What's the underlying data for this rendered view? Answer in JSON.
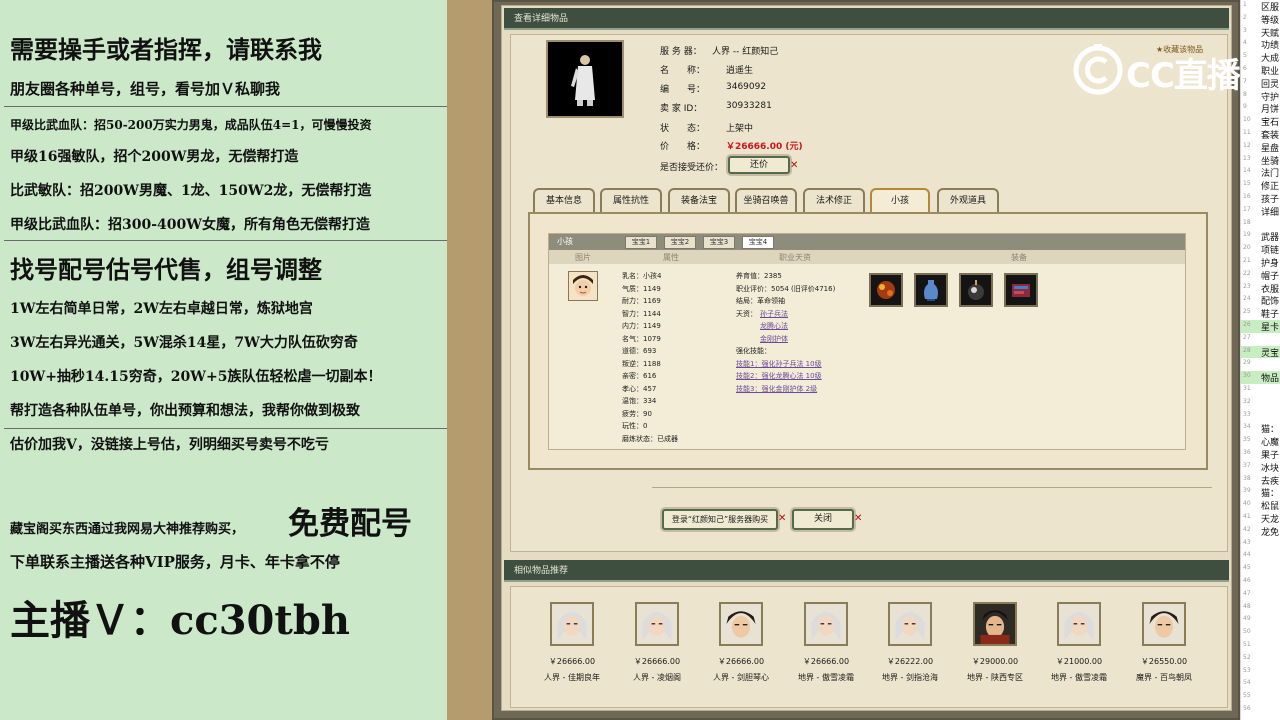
{
  "ad": {
    "lines": [
      "需要操手或者指挥，请联系我",
      "朋友圈各种单号，组号，看号加Ｖ私聊我",
      "甲级比武血队：招50-200万实力男鬼，成品队伍4=1，可慢慢投资",
      "甲级16强敏队，招个200W男龙，无偿帮打造",
      "比武敏队：招200W男魔、1龙、150W2龙，无偿帮打造",
      "甲级比武血队：招300-400W女魔，所有角色无偿帮打造",
      "找号配号估号代售，组号调整",
      "1W左右简单日常，2W左右卓越日常，炼狱地宫",
      "3W左右异光通关，5W混杀14星，7W大力队伍砍穷奇",
      "10W+抽秒14.15穷奇，20W+5族队伍轻松虐一切副本！",
      "帮打造各种队伍单号，你出预算和想法，我帮你做到极致",
      "估价加我V，没链接上号估，列明细买号卖号不吃亏",
      "藏宝阁买东西通过我网易大神推荐购买，",
      "免费配号",
      "下单联系主播送各种VIP服务，月卡、年卡拿不停",
      "主播Ｖ：cc30tbh"
    ]
  },
  "watermark": {
    "brand": "CC直播"
  },
  "detail": {
    "title": "查看详细物品",
    "favorite": "收藏该物品",
    "info": [
      {
        "label": "服 务 器：",
        "value": "人界 -- 红颜知己"
      },
      {
        "label": "名　　称：",
        "value": "逍遥生"
      },
      {
        "label": "编　　号：",
        "value": "3469092"
      },
      {
        "label": "卖 家 ID：",
        "value": "30933281"
      },
      {
        "label": "状　　态：",
        "value": "上架中"
      },
      {
        "label": "价　　格：",
        "value": "￥26666.00 (元)"
      }
    ],
    "bargain_label": "是否接受还价：",
    "bargain_button": "还价",
    "tabs": [
      "基本信息",
      "属性抗性",
      "装备法宝",
      "坐骑召唤兽",
      "法术修正",
      "小孩",
      "外观道具"
    ],
    "active_tab": 5,
    "child": {
      "title": "小孩",
      "subtabs": [
        "宝宝1",
        "宝宝2",
        "宝宝3",
        "宝宝4"
      ],
      "col_image": "图片",
      "col_attr": "属性",
      "col_skill": "职业天资",
      "col_equip": "装备",
      "stats": [
        "乳名：小孩4",
        "气质：1149",
        "耐力：1169",
        "智力：1144",
        "内力：1149",
        "名气：1079",
        "道德：693",
        "叛逆：1188",
        "亲密：616",
        "孝心：457",
        "温饱：334",
        "疲劳：90",
        "玩性：0",
        "磨炼状态：已成器"
      ],
      "career": [
        "养育值：2385",
        "职业评价：5054 (旧评价4716)",
        "结局：革命领袖"
      ],
      "talent_label": "天资：",
      "talents": [
        "孙子兵法",
        "龙腾心法",
        "金刚护体"
      ],
      "enhance_label": "强化技能：",
      "enhances": [
        "技能1：强化孙子兵法 10级",
        "技能2：强化龙腾心法 10级",
        "技能3：强化金刚护体 2级"
      ]
    },
    "login_button": "登录“红颜知己”服务器购买",
    "close_button": "关闭"
  },
  "recommend": {
    "title": "相似物品推荐",
    "items": [
      {
        "price": "￥26666.00",
        "server": "人界 - 佳期良年"
      },
      {
        "price": "￥26666.00",
        "server": "人界 - 凌烟阁"
      },
      {
        "price": "￥26666.00",
        "server": "人界 - 剑胆琴心"
      },
      {
        "price": "￥26666.00",
        "server": "地界 - 傲雪凌霜"
      },
      {
        "price": "￥26222.00",
        "server": "地界 - 剑指沧海"
      },
      {
        "price": "￥29000.00",
        "server": "地界 - 陕西专区"
      },
      {
        "price": "￥21000.00",
        "server": "地界 - 傲雪凌霜"
      },
      {
        "price": "￥26550.00",
        "server": "魔界 - 百鸟朝凤"
      }
    ]
  },
  "right_strip": [
    {
      "n": "1",
      "t": "区服"
    },
    {
      "n": "2",
      "t": "等级"
    },
    {
      "n": "3",
      "t": "天赋"
    },
    {
      "n": "4",
      "t": "功绩"
    },
    {
      "n": "5",
      "t": "大成"
    },
    {
      "n": "6",
      "t": "职业"
    },
    {
      "n": "7",
      "t": "回灵"
    },
    {
      "n": "8",
      "t": "守护"
    },
    {
      "n": "9",
      "t": "月饼"
    },
    {
      "n": "10",
      "t": "宝石"
    },
    {
      "n": "11",
      "t": "套装"
    },
    {
      "n": "12",
      "t": "星盘"
    },
    {
      "n": "13",
      "t": "坐骑"
    },
    {
      "n": "14",
      "t": "法门"
    },
    {
      "n": "15",
      "t": "修正"
    },
    {
      "n": "16",
      "t": "孩子"
    },
    {
      "n": "17",
      "t": "详细"
    },
    {
      "n": "18",
      "t": ""
    },
    {
      "n": "19",
      "t": "武器"
    },
    {
      "n": "20",
      "t": "项链"
    },
    {
      "n": "21",
      "t": "护身"
    },
    {
      "n": "22",
      "t": "帽子"
    },
    {
      "n": "23",
      "t": "衣服"
    },
    {
      "n": "24",
      "t": "配饰"
    },
    {
      "n": "25",
      "t": "鞋子"
    },
    {
      "n": "26",
      "t": "星卡"
    },
    {
      "n": "27",
      "t": ""
    },
    {
      "n": "28",
      "t": "灵宝"
    },
    {
      "n": "29",
      "t": ""
    },
    {
      "n": "30",
      "t": "物品"
    },
    {
      "n": "31",
      "t": ""
    },
    {
      "n": "32",
      "t": ""
    },
    {
      "n": "33",
      "t": ""
    },
    {
      "n": "34",
      "t": "猫："
    },
    {
      "n": "35",
      "t": "心魔"
    },
    {
      "n": "36",
      "t": "果子"
    },
    {
      "n": "37",
      "t": "冰块"
    },
    {
      "n": "38",
      "t": "去疾"
    },
    {
      "n": "39",
      "t": "猫："
    },
    {
      "n": "40",
      "t": "松鼠"
    },
    {
      "n": "41",
      "t": "天龙"
    },
    {
      "n": "42",
      "t": "龙免"
    },
    {
      "n": "43",
      "t": ""
    },
    {
      "n": "44",
      "t": ""
    },
    {
      "n": "45",
      "t": ""
    },
    {
      "n": "46",
      "t": ""
    },
    {
      "n": "47",
      "t": ""
    },
    {
      "n": "48",
      "t": ""
    },
    {
      "n": "49",
      "t": ""
    },
    {
      "n": "50",
      "t": ""
    },
    {
      "n": "51",
      "t": ""
    },
    {
      "n": "52",
      "t": ""
    },
    {
      "n": "53",
      "t": ""
    },
    {
      "n": "54",
      "t": ""
    },
    {
      "n": "55",
      "t": ""
    },
    {
      "n": "56",
      "t": ""
    }
  ],
  "right_strip_highlight": [
    26,
    28,
    30
  ]
}
